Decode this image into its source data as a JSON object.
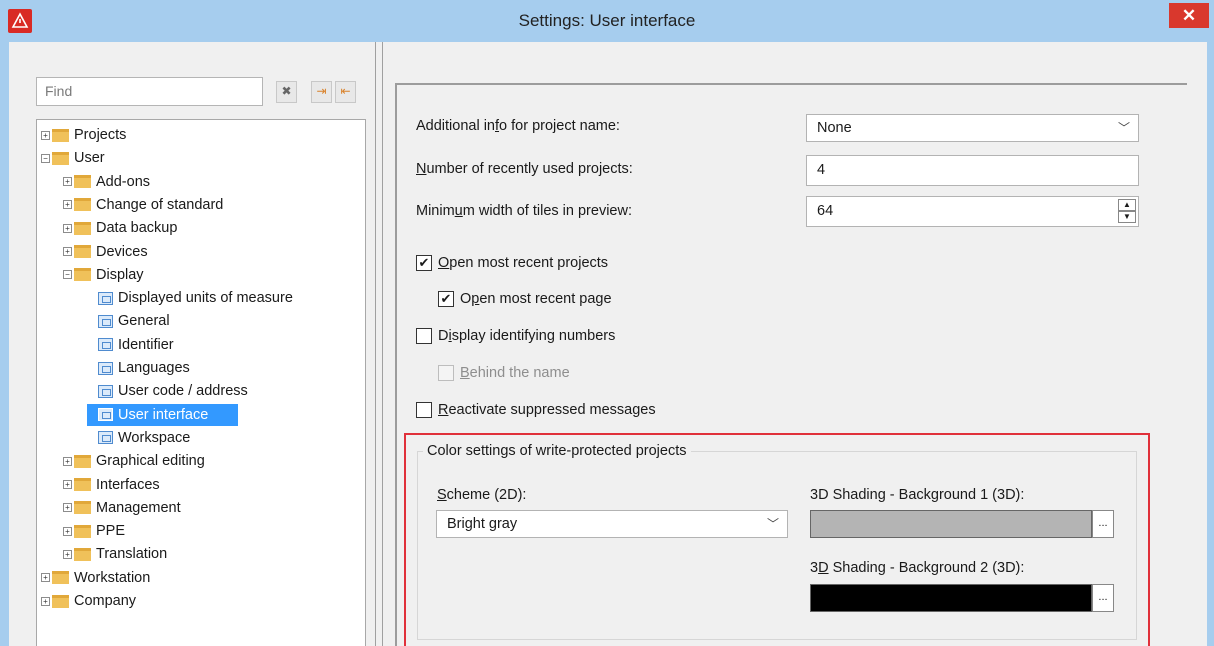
{
  "window": {
    "title": "Settings: User interface",
    "close_glyph": "✕",
    "app_icon": "warning-triangle-icon"
  },
  "sidebar": {
    "find_placeholder": "Find",
    "buttons": [
      "clear-icon",
      "expand-icon",
      "collapse-icon"
    ],
    "tree": [
      {
        "label": "Projects",
        "level": 0,
        "type": "folder",
        "expander": "+"
      },
      {
        "label": "User",
        "level": 0,
        "type": "folder",
        "expander": "−"
      },
      {
        "label": "Add-ons",
        "level": 1,
        "type": "folder",
        "expander": "+"
      },
      {
        "label": "Change of standard",
        "level": 1,
        "type": "folder",
        "expander": "+"
      },
      {
        "label": "Data backup",
        "level": 1,
        "type": "folder",
        "expander": "+"
      },
      {
        "label": "Devices",
        "level": 1,
        "type": "folder",
        "expander": "+"
      },
      {
        "label": "Display",
        "level": 1,
        "type": "folder",
        "expander": "−"
      },
      {
        "label": "Displayed units of measure",
        "level": 2,
        "type": "page"
      },
      {
        "label": "General",
        "level": 2,
        "type": "page"
      },
      {
        "label": "Identifier",
        "level": 2,
        "type": "page"
      },
      {
        "label": "Languages",
        "level": 2,
        "type": "page"
      },
      {
        "label": "User code / address",
        "level": 2,
        "type": "page"
      },
      {
        "label": "User interface",
        "level": 2,
        "type": "page",
        "selected": true
      },
      {
        "label": "Workspace",
        "level": 2,
        "type": "page"
      },
      {
        "label": "Graphical editing",
        "level": 1,
        "type": "folder",
        "expander": "+"
      },
      {
        "label": "Interfaces",
        "level": 1,
        "type": "folder",
        "expander": "+"
      },
      {
        "label": "Management",
        "level": 1,
        "type": "folder",
        "expander": "+"
      },
      {
        "label": "PPE",
        "level": 1,
        "type": "folder",
        "expander": "+"
      },
      {
        "label": "Translation",
        "level": 1,
        "type": "folder",
        "expander": "+"
      },
      {
        "label": "Workstation",
        "level": 0,
        "type": "folder",
        "expander": "+"
      },
      {
        "label": "Company",
        "level": 0,
        "type": "folder",
        "expander": "+"
      }
    ]
  },
  "form": {
    "additional_info": {
      "pre": "Additional in",
      "u": "f",
      "post": "o for project name:",
      "value": "None"
    },
    "recent_projects": {
      "pre": "",
      "u": "N",
      "post": "umber of recently used projects:",
      "value": "4"
    },
    "min_width": {
      "pre": "Minim",
      "u": "u",
      "post": "m width of tiles in preview:",
      "value": "64"
    },
    "open_recent_projects": {
      "pre": "",
      "u": "O",
      "post": "pen most recent projects",
      "checked": true
    },
    "open_recent_page": {
      "pre": "O",
      "u": "p",
      "post": "en most recent page",
      "checked": true
    },
    "display_ids": {
      "pre": "D",
      "u": "i",
      "post": "splay identifying numbers",
      "checked": false
    },
    "behind_name": {
      "pre": "",
      "u": "B",
      "post": "ehind the name",
      "checked": false,
      "disabled": true
    },
    "reactivate": {
      "pre": "",
      "u": "R",
      "post": "eactivate suppressed messages",
      "checked": false
    }
  },
  "color_group": {
    "title": "Color settings of write-protected projects",
    "scheme": {
      "pre": "",
      "u": "S",
      "post": "cheme (2D):",
      "value": "Bright gray"
    },
    "bg1": {
      "pre": "3D Shading - Background 1 (3D):",
      "u": "",
      "post": "",
      "color": "#b4b4b4"
    },
    "bg2": {
      "pre": "3",
      "u": "D",
      "post": " Shading - Background 2 (3D):",
      "color": "#000000"
    },
    "ellipsis": "..."
  },
  "colors": {
    "accent_selection": "#3399ff",
    "titlebar": "#a6cdee",
    "highlight": "#e0303a"
  }
}
